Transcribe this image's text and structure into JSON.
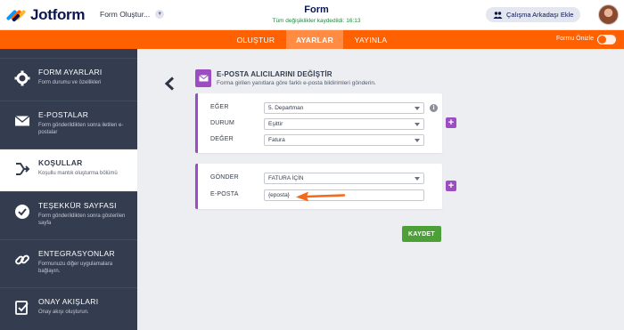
{
  "header": {
    "logo_text": "Jotform",
    "form_selector": "Form Oluştur...",
    "form_title": "Form",
    "save_status": "Tüm değişiklikler kaydedildi: 16:13",
    "add_colleague": "Çalışma Arkadaşı Ekle"
  },
  "nav": {
    "tabs": [
      {
        "label": "OLUŞTUR"
      },
      {
        "label": "AYARLAR"
      },
      {
        "label": "YAYINLA"
      }
    ],
    "preview_label": "Formu Önizle",
    "colors": {
      "brand": "#ff6100",
      "active_tab": "#ff8c42"
    }
  },
  "sidebar": {
    "items": [
      {
        "title": "FORM AYARLARI",
        "desc": "Form durumu ve özellikleri",
        "icon": "gear-icon"
      },
      {
        "title": "E-POSTALAR",
        "desc": "Form gönderildikten sonra iletilen e-postalar",
        "icon": "envelope-icon"
      },
      {
        "title": "KOŞULLAR",
        "desc": "Koşullu mantık oluşturma bölümü",
        "icon": "conditions-icon"
      },
      {
        "title": "TEŞEKKÜR SAYFASI",
        "desc": "Form gönderildikten sonra gösterilen sayfa",
        "icon": "check-circle-icon"
      },
      {
        "title": "ENTEGRASYONLAR",
        "desc": "Formunuzu diğer uygulamalara bağlayın.",
        "icon": "link-icon"
      },
      {
        "title": "ONAY AKIŞLARI",
        "desc": "Onay akışı oluşturun.",
        "icon": "approval-icon"
      }
    ]
  },
  "main": {
    "card_title": "E-POSTA ALICILARINI DEĞİŞTİR",
    "card_desc": "Forma girilen yanıtlara göre farklı e-posta bildirimleri gönderin.",
    "condition": {
      "if_label": "EĞER",
      "if_value": "5. Departman",
      "state_label": "DURUM",
      "state_value": "Eşittir",
      "value_label": "DEĞER",
      "value_value": "Fatura"
    },
    "action": {
      "send_label": "GÖNDER",
      "send_value": "FATURA İÇİN",
      "email_label": "E-POSTA",
      "email_value": "{eposta}"
    },
    "save_label": "KAYDET",
    "accent": "#9c4dc2",
    "save_color": "#4d9f37",
    "annotation_arrow_color": "#f26a1b"
  }
}
